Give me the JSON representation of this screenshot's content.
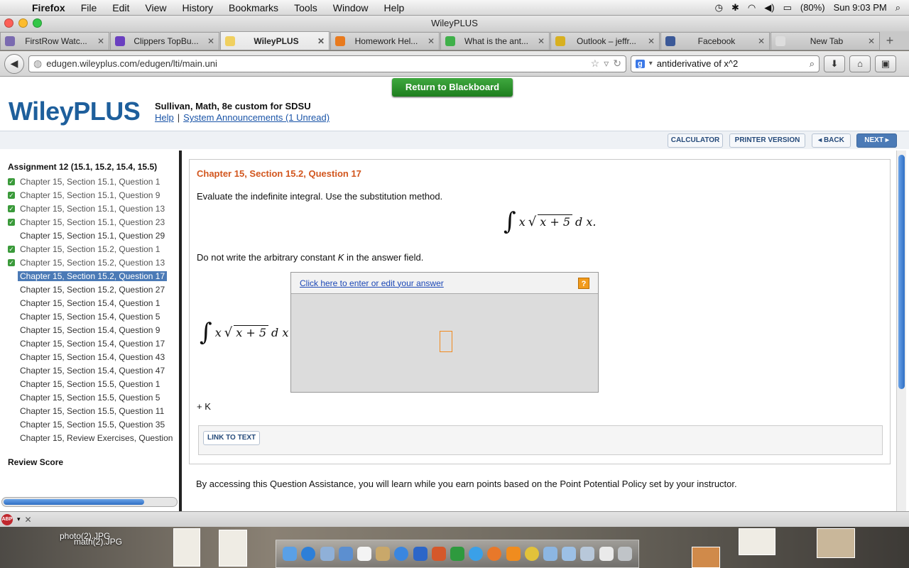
{
  "menubar": {
    "app": "Firefox",
    "items": [
      "File",
      "Edit",
      "View",
      "History",
      "Bookmarks",
      "Tools",
      "Window",
      "Help"
    ],
    "battery": "(80%)",
    "clock": "Sun 9:03 PM"
  },
  "window": {
    "title": "WileyPLUS"
  },
  "tabs": [
    {
      "label": "FirstRow Watc...",
      "color": "#7a6ab0"
    },
    {
      "label": "Clippers TopBu...",
      "color": "#6a3fc0"
    },
    {
      "label": "WileyPLUS",
      "color": "#f0d060",
      "active": true
    },
    {
      "label": "Homework Hel...",
      "color": "#e87a1e"
    },
    {
      "label": "What is the ant...",
      "color": "#3fb04a"
    },
    {
      "label": "Outlook – jeffr...",
      "color": "#d8b020"
    },
    {
      "label": "Facebook",
      "color": "#3b5998"
    },
    {
      "label": "New Tab",
      "color": "#dddddd"
    }
  ],
  "nav": {
    "url": "edugen.wileyplus.com/edugen/lti/main.uni",
    "search_value": "antiderivative of x^2"
  },
  "header": {
    "return_button": "Return to Blackboard",
    "logo": "WileyPLUS",
    "course": "Sullivan, Math, 8e custom for SDSU",
    "help_link": "Help",
    "separator": "|",
    "announcements_link": "System Announcements (1 Unread)"
  },
  "toolbar": {
    "calculator": "CALCULATOR",
    "printer": "PRINTER VERSION",
    "back": "◂ BACK",
    "next": "NEXT ▸"
  },
  "sidebar": {
    "title": "Assignment 12 (15.1, 15.2, 15.4, 15.5)",
    "questions": [
      {
        "label": "Chapter 15, Section 15.1, Question 1",
        "done": true
      },
      {
        "label": "Chapter 15, Section 15.1, Question 9",
        "done": true
      },
      {
        "label": "Chapter 15, Section 15.1, Question 13",
        "done": true
      },
      {
        "label": "Chapter 15, Section 15.1, Question 23",
        "done": true
      },
      {
        "label": "Chapter 15, Section 15.1, Question 29",
        "done": false
      },
      {
        "label": "Chapter 15, Section 15.2, Question 1",
        "done": true
      },
      {
        "label": "Chapter 15, Section 15.2, Question 13",
        "done": true
      },
      {
        "label": "Chapter 15, Section 15.2, Question 17",
        "done": false,
        "selected": true
      },
      {
        "label": "Chapter 15, Section 15.2, Question 27",
        "done": false
      },
      {
        "label": "Chapter 15, Section 15.4, Question 1",
        "done": false
      },
      {
        "label": "Chapter 15, Section 15.4, Question 5",
        "done": false
      },
      {
        "label": "Chapter 15, Section 15.4, Question 9",
        "done": false
      },
      {
        "label": "Chapter 15, Section 15.4, Question 17",
        "done": false
      },
      {
        "label": "Chapter 15, Section 15.4, Question 43",
        "done": false
      },
      {
        "label": "Chapter 15, Section 15.4, Question 47",
        "done": false
      },
      {
        "label": "Chapter 15, Section 15.5, Question 1",
        "done": false
      },
      {
        "label": "Chapter 15, Section 15.5, Question 5",
        "done": false
      },
      {
        "label": "Chapter 15, Section 15.5, Question 11",
        "done": false
      },
      {
        "label": "Chapter 15, Section 15.5, Question 35",
        "done": false
      },
      {
        "label": "Chapter 15, Review Exercises, Question",
        "done": false
      }
    ],
    "review_score": "Review Score"
  },
  "question": {
    "title": "Chapter 15, Section 15.2, Question 17",
    "instruction": "Evaluate the indefinite integral. Use the substitution method.",
    "integral_sign": "∫",
    "integrand_x": "x",
    "radical_sign": "√",
    "radicand": "x + 5",
    "differential": "d x.",
    "differential_eq": "d x =",
    "note_prefix": "Do not write the arbitrary constant ",
    "note_var": "K",
    "note_suffix": " in the answer field.",
    "answer_link": "Click here to enter or edit your answer",
    "help_icon": "?",
    "plus_k": "+ K",
    "link_to_text": "LINK TO TEXT",
    "assistance": "By accessing this Question Assistance, you will learn while you earn points based on the Point Potential Policy set by your instructor."
  },
  "desktop": {
    "file1": "photo(2).JPG",
    "file2": "math(2).JPG"
  }
}
